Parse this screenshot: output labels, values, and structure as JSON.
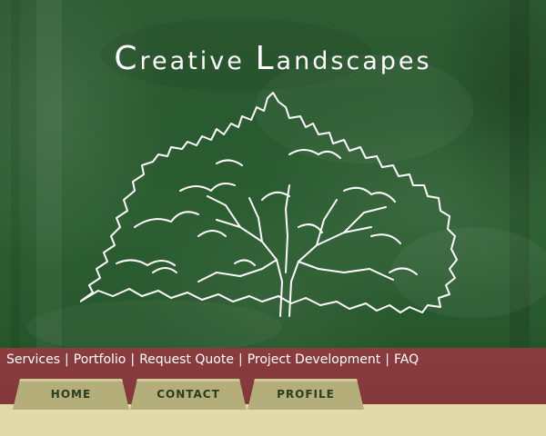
{
  "site": {
    "title_first_cap": "C",
    "title_first_rest": "reative",
    "title_second_cap": "L",
    "title_second_rest": "andscapes"
  },
  "nav": {
    "links": [
      "Services",
      "Portfolio",
      "Request Quote",
      "Project Development",
      "FAQ"
    ],
    "separator": "|"
  },
  "tabs": [
    "HOME",
    "CONTACT",
    "PROFILE"
  ],
  "colors": {
    "hero_green": "#2c5e31",
    "nav_maroon": "#863a3c",
    "tab_khaki": "#b4ae7a",
    "content_cream": "#e0dba8"
  }
}
